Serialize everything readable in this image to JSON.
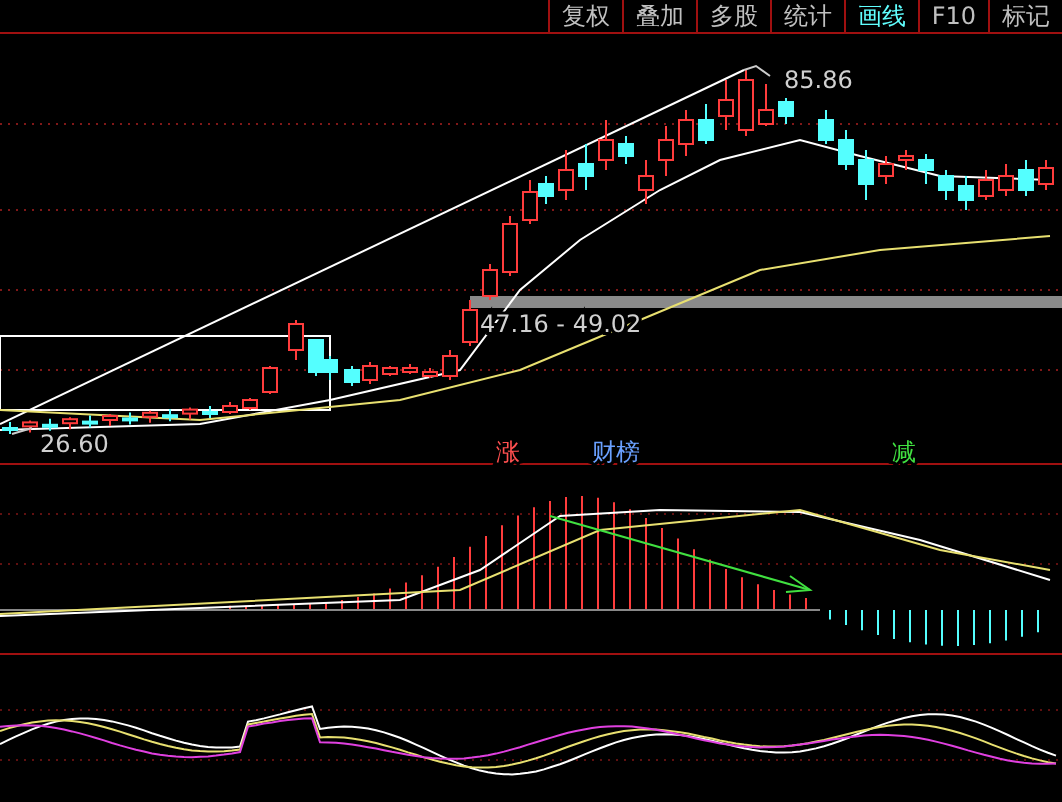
{
  "toolbar": {
    "tabs": [
      {
        "label": "复权",
        "selected": false
      },
      {
        "label": "叠加",
        "selected": false
      },
      {
        "label": "多股",
        "selected": false
      },
      {
        "label": "统计",
        "selected": false
      },
      {
        "label": "画线",
        "selected": true
      },
      {
        "label": "F10",
        "selected": false
      },
      {
        "label": "标记",
        "selected": false
      }
    ]
  },
  "price_chart": {
    "high_label": "85.86",
    "low_label": "26.60",
    "range_label": "47.16 - 49.02"
  },
  "event_markers": [
    {
      "label": "涨",
      "color": "#ff5050"
    },
    {
      "label": "财榜",
      "color": "#6aa0ff"
    },
    {
      "label": "减",
      "color": "#40e040"
    }
  ]
}
